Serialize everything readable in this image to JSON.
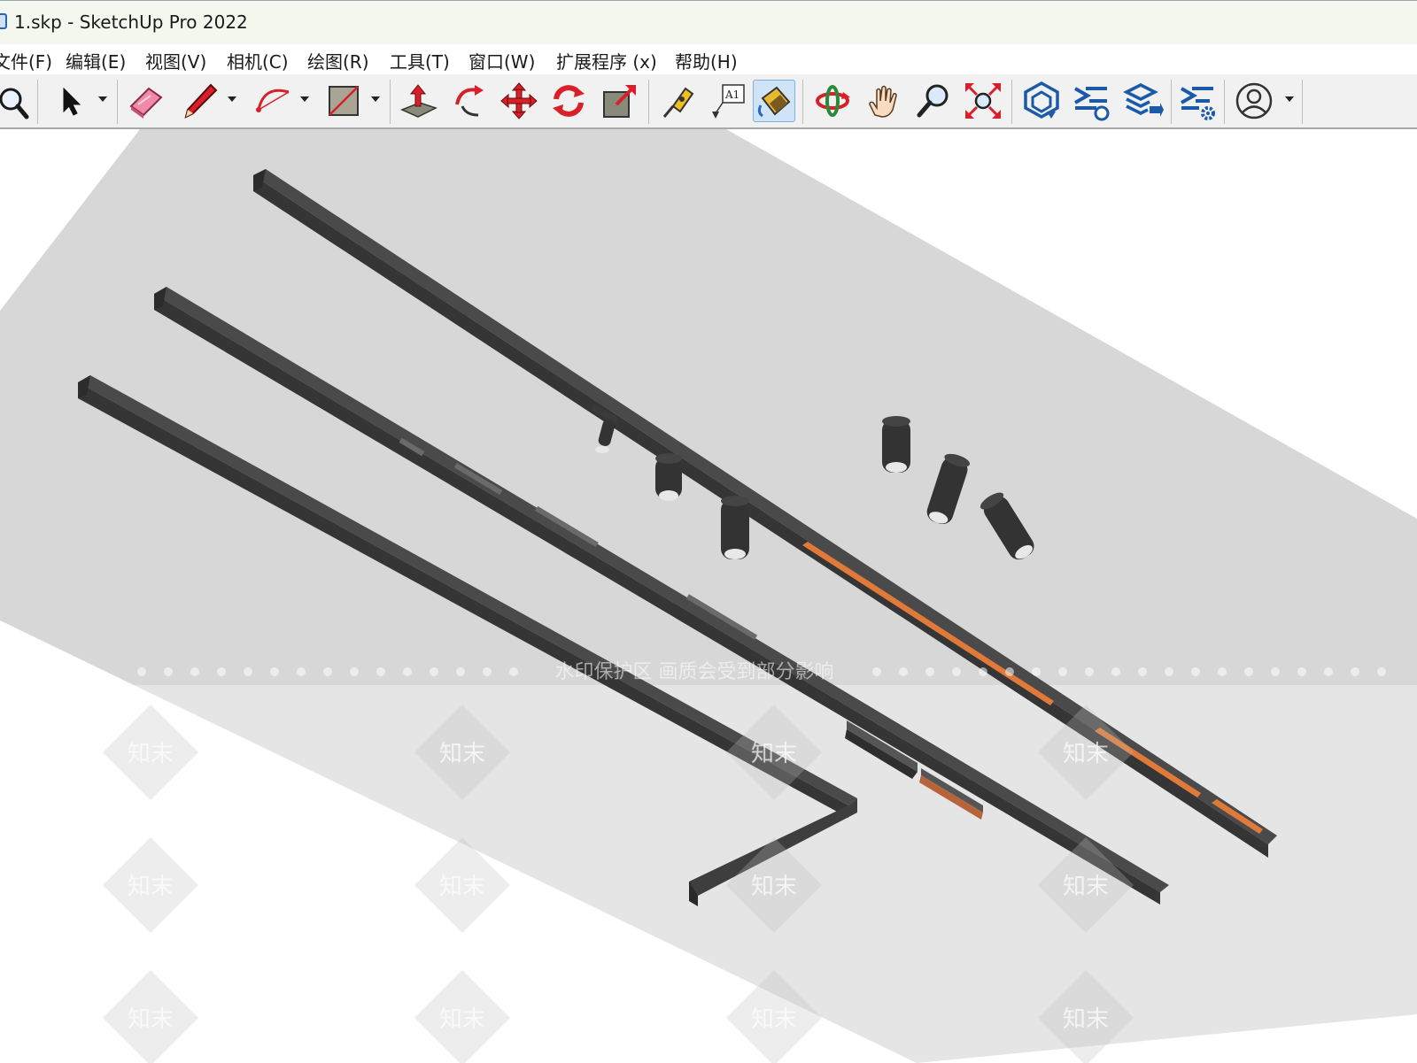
{
  "window": {
    "title": "1.skp - SketchUp Pro 2022"
  },
  "menu": [
    "文件(F)",
    "编辑(E)",
    "视图(V)",
    "相机(C)",
    "绘图(R)",
    "工具(T)",
    "窗口(W)",
    "扩展程序 (x)",
    "帮助(H)"
  ],
  "toolbar": {
    "active_tool": "paint-bucket-tool",
    "tools": [
      "zoom-extents-icon",
      "select-icon",
      "eraser-icon",
      "pencil-icon",
      "arc-icon",
      "rectangle-icon",
      "push-pull-icon",
      "follow-me-icon",
      "move-icon",
      "rotate-icon",
      "scale-icon",
      "tape-measure-icon",
      "text-label-icon",
      "paint-bucket-icon",
      "orbit-icon",
      "pan-hand-icon",
      "zoom-icon",
      "zoom-extents-arrows-icon",
      "warehouse-icon",
      "extension-warehouse-icon",
      "layers-send-icon",
      "extension-manager-icon",
      "account-icon"
    ]
  },
  "viewport": {
    "watermark_banner": "水印保护区   画质会受到部分影响",
    "watermark_tiles": [
      "知末"
    ],
    "colors": {
      "ceiling": "#d7d7d7",
      "track": "#3a3a3a",
      "track_top": "#474747",
      "accent_strip": "#e07a3a",
      "spotlight": "#333333"
    }
  }
}
